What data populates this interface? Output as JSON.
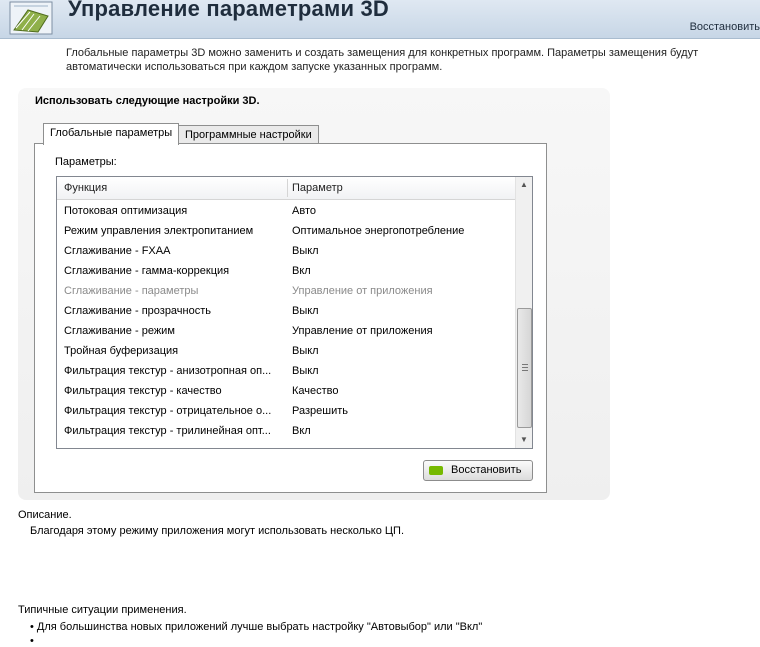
{
  "header": {
    "title": "Управление параметрами 3D",
    "restore_link": "Восстановить"
  },
  "intro": "Глобальные параметры 3D можно заменить и создать замещения для конкретных программ. Параметры замещения будут автоматически использоваться при каждом запуске указанных программ.",
  "section": {
    "title": "Использовать следующие настройки 3D.",
    "tabs": [
      {
        "label": "Глобальные параметры",
        "active": true
      },
      {
        "label": "Программные настройки",
        "active": false
      }
    ],
    "params_label": "Параметры:",
    "columns": [
      "Функция",
      "Параметр"
    ],
    "rows": [
      {
        "function": "Потоковая оптимизация",
        "value": "Авто"
      },
      {
        "function": "Режим управления электропитанием",
        "value": "Оптимальное энергопотребление"
      },
      {
        "function": "Сглаживание - FXAA",
        "value": "Выкл"
      },
      {
        "function": "Сглаживание - гамма-коррекция",
        "value": "Вкл"
      },
      {
        "function": "Сглаживание - параметры",
        "value": "Управление от приложения"
      },
      {
        "function": "Сглаживание - прозрачность",
        "value": "Выкл"
      },
      {
        "function": "Сглаживание - режим",
        "value": "Управление от приложения"
      },
      {
        "function": "Тройная буферизация",
        "value": "Выкл"
      },
      {
        "function": "Фильтрация текстур - анизотропная оп...",
        "value": "Выкл"
      },
      {
        "function": "Фильтрация текстур - качество",
        "value": "Качество"
      },
      {
        "function": "Фильтрация текстур - отрицательное о...",
        "value": "Разрешить"
      },
      {
        "function": "Фильтрация текстур - трилинейная опт...",
        "value": "Вкл"
      }
    ],
    "restore_button": "Восстановить"
  },
  "description": {
    "title": "Описание.",
    "text": "Благодаря этому режиму приложения могут использовать несколько ЦП."
  },
  "usage": {
    "title": "Типичные ситуации применения.",
    "items": [
      "• Для большинства новых приложений лучше выбрать настройку \"Автовыбор\" или \"Вкл\"",
      "•"
    ]
  },
  "colors": {
    "accent": "#76b900",
    "header_bg": "#c7d6e6",
    "disabled_text": "#8a8a8a"
  },
  "icons": [
    "nvidia-3d-logo-icon",
    "nvidia-eye-icon",
    "scroll-up-icon",
    "scroll-down-icon"
  ]
}
